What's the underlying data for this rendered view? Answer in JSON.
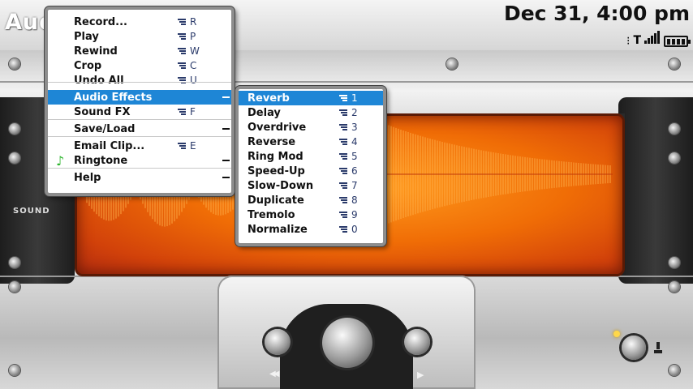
{
  "app": {
    "title": "AudioBox+"
  },
  "status": {
    "clock": "Dec 31, 4:00 pm"
  },
  "device": {
    "sound_label": "SOUND"
  },
  "main_menu": {
    "items": [
      {
        "label": "Record...",
        "shortcut": "R"
      },
      {
        "label": "Play",
        "shortcut": "P"
      },
      {
        "label": "Rewind",
        "shortcut": "W"
      },
      {
        "label": "Crop",
        "shortcut": "C"
      },
      {
        "label": "Undo All",
        "shortcut": "U"
      },
      {
        "label": "Audio Effects",
        "shortcut": "",
        "submenu": true,
        "selected": true
      },
      {
        "label": "Sound FX",
        "shortcut": "F"
      },
      {
        "label": "Save/Load",
        "shortcut": "",
        "submenu": true
      },
      {
        "label": "Email Clip...",
        "shortcut": "E"
      },
      {
        "label": "Ringtone",
        "shortcut": "",
        "submenu": true,
        "icon": "music-note-icon"
      },
      {
        "label": "Help",
        "shortcut": "",
        "submenu": true
      }
    ]
  },
  "effects_menu": {
    "items": [
      {
        "label": "Reverb",
        "shortcut": "1",
        "selected": true
      },
      {
        "label": "Delay",
        "shortcut": "2"
      },
      {
        "label": "Overdrive",
        "shortcut": "3"
      },
      {
        "label": "Reverse",
        "shortcut": "4"
      },
      {
        "label": "Ring Mod",
        "shortcut": "5"
      },
      {
        "label": "Speed-Up",
        "shortcut": "6"
      },
      {
        "label": "Slow-Down",
        "shortcut": "7"
      },
      {
        "label": "Duplicate",
        "shortcut": "8"
      },
      {
        "label": "Tremolo",
        "shortcut": "9"
      },
      {
        "label": "Normalize",
        "shortcut": "0"
      }
    ]
  },
  "controls": {
    "rewind_glyph": "◀◀",
    "play_glyph": "▶"
  },
  "colors": {
    "menu_highlight": "#1e86d6",
    "display_orange": "#f06d06",
    "music_note": "#2db52d"
  }
}
